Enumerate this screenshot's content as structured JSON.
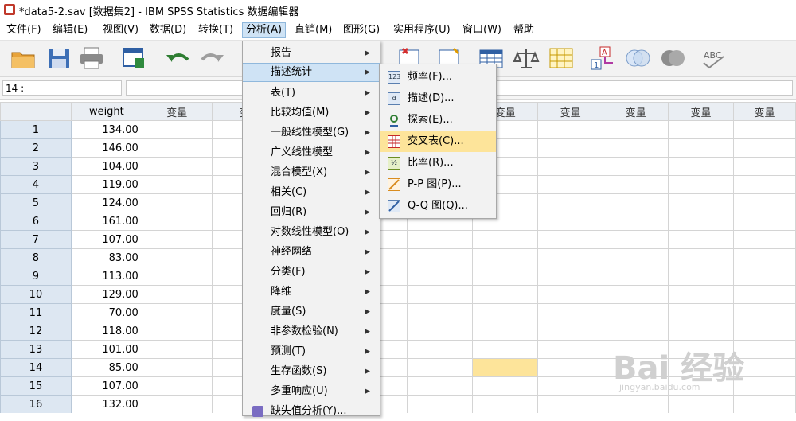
{
  "window": {
    "title": "*data5-2.sav [数据集2] - IBM SPSS Statistics 数据编辑器"
  },
  "menubar": [
    {
      "label": "文件(F)"
    },
    {
      "label": "编辑(E)"
    },
    {
      "label": "视图(V)"
    },
    {
      "label": "数据(D)"
    },
    {
      "label": "转换(T)"
    },
    {
      "label": "分析(A)"
    },
    {
      "label": "直销(M)"
    },
    {
      "label": "图形(G)"
    },
    {
      "label": "实用程序(U)"
    },
    {
      "label": "窗口(W)"
    },
    {
      "label": "帮助"
    }
  ],
  "cell_indicator": {
    "ref": "14 :",
    "value": ""
  },
  "grid": {
    "columns": [
      "weight",
      "变量",
      "变",
      "变量",
      "变量",
      "变量",
      "变量",
      "变量"
    ],
    "rows": [
      {
        "n": "1",
        "weight": "134.00"
      },
      {
        "n": "2",
        "weight": "146.00"
      },
      {
        "n": "3",
        "weight": "104.00"
      },
      {
        "n": "4",
        "weight": "119.00"
      },
      {
        "n": "5",
        "weight": "124.00"
      },
      {
        "n": "6",
        "weight": "161.00"
      },
      {
        "n": "7",
        "weight": "107.00"
      },
      {
        "n": "8",
        "weight": "83.00"
      },
      {
        "n": "9",
        "weight": "113.00"
      },
      {
        "n": "10",
        "weight": "129.00"
      },
      {
        "n": "11",
        "weight": "70.00"
      },
      {
        "n": "12",
        "weight": "118.00"
      },
      {
        "n": "13",
        "weight": "101.00"
      },
      {
        "n": "14",
        "weight": "85.00"
      },
      {
        "n": "15",
        "weight": "107.00"
      },
      {
        "n": "16",
        "weight": "132.00"
      }
    ]
  },
  "analyze_menu": {
    "items": [
      {
        "label": "报告"
      },
      {
        "label": "描述统计"
      },
      {
        "label": "表(T)"
      },
      {
        "label": "比较均值(M)"
      },
      {
        "label": "一般线性模型(G)"
      },
      {
        "label": "广义线性模型"
      },
      {
        "label": "混合模型(X)"
      },
      {
        "label": "相关(C)"
      },
      {
        "label": "回归(R)"
      },
      {
        "label": "对数线性模型(O)"
      },
      {
        "label": "神经网络"
      },
      {
        "label": "分类(F)"
      },
      {
        "label": "降维"
      },
      {
        "label": "度量(S)"
      },
      {
        "label": "非参数检验(N)"
      },
      {
        "label": "预测(T)"
      },
      {
        "label": "生存函数(S)"
      },
      {
        "label": "多重响应(U)"
      },
      {
        "label": "缺失值分析(Y)..."
      }
    ]
  },
  "descriptive_submenu": {
    "items": [
      {
        "label": "频率(F)...",
        "icon": "123"
      },
      {
        "label": "描述(D)...",
        "icon": "d"
      },
      {
        "label": "探索(E)...",
        "icon": "explore"
      },
      {
        "label": "交叉表(C)...",
        "icon": "crosstab"
      },
      {
        "label": "比率(R)...",
        "icon": "1/2"
      },
      {
        "label": "P-P 图(P)...",
        "icon": "pp"
      },
      {
        "label": "Q-Q 图(Q)...",
        "icon": "qq"
      }
    ]
  },
  "watermark": {
    "brand": "Bai 经验",
    "url": "jingyan.baidu.com"
  }
}
